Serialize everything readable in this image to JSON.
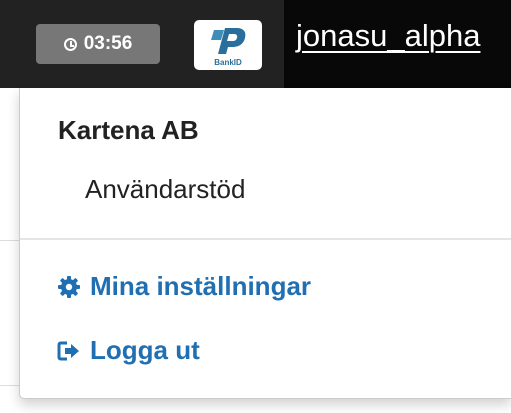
{
  "navbar": {
    "session_timer": "03:56",
    "bankid_logo_text": "BankID",
    "username": "jonasu_alpha"
  },
  "dropdown": {
    "header": "Kartena AB",
    "items": [
      {
        "label": "Användarstöd",
        "icon": null
      },
      {
        "label": "Mina inställningar",
        "icon": "gear-icon"
      },
      {
        "label": "Logga ut",
        "icon": "sign-out-icon"
      }
    ]
  },
  "colors": {
    "navbar_bg": "#222222",
    "timer_badge_bg": "#777777",
    "link": "#1f6fb2",
    "text": "#222222"
  }
}
